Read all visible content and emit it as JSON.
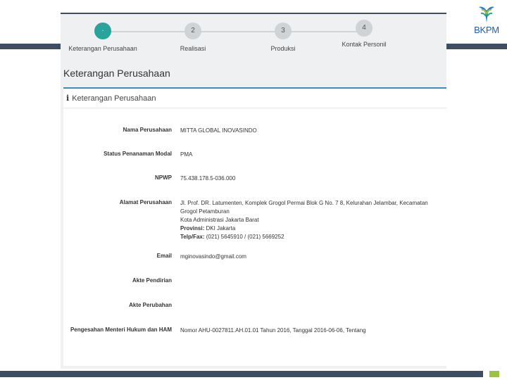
{
  "logo": {
    "text": "BKPM"
  },
  "stepper": {
    "steps": [
      {
        "number": "·",
        "label": "Keterangan Perusahaan"
      },
      {
        "number": "2",
        "label": "Realisasi"
      },
      {
        "number": "3",
        "label": "Produksi"
      },
      {
        "number": "4",
        "label": "Kontak Personil"
      }
    ]
  },
  "page": {
    "title": "Keterangan Perusahaan"
  },
  "card": {
    "header": "Keterangan Perusahaan",
    "fields": [
      {
        "label": "Nama Perusahaan",
        "value": "MITTA GLOBAL INOVASINDO"
      },
      {
        "label": "Status Penanaman Modal",
        "value": "PMA"
      },
      {
        "label": "NPWP",
        "value": "75.438.178.5-036.000"
      },
      {
        "label": "Alamat Perusahaan",
        "value": "Jl. Prof. DR. Latumenten, Komplek Grogol Permai Blok G No. 7 8, Kelurahan Jelambar, Kecamatan Grogol Petamburan",
        "value2": "Kota Administrasi Jakarta Barat",
        "provinsi_label": "Provinsi:",
        "provinsi": "DKI Jakarta",
        "telp_label": "Telp/Fax:",
        "telp": "(021) 5645910 / (021) 5669252"
      },
      {
        "label": "Email",
        "value": "mginovasindo@gmail.com"
      },
      {
        "label": "Akte Pendirian",
        "value": ""
      },
      {
        "label": "Akte Perubahan",
        "value": ""
      },
      {
        "label": "Pengesahan Menteri Hukum dan HAM",
        "value": "Nomor AHU-0027811.AH.01.01 Tahun 2016, Tanggal 2016-06-06, Tentang"
      }
    ]
  }
}
